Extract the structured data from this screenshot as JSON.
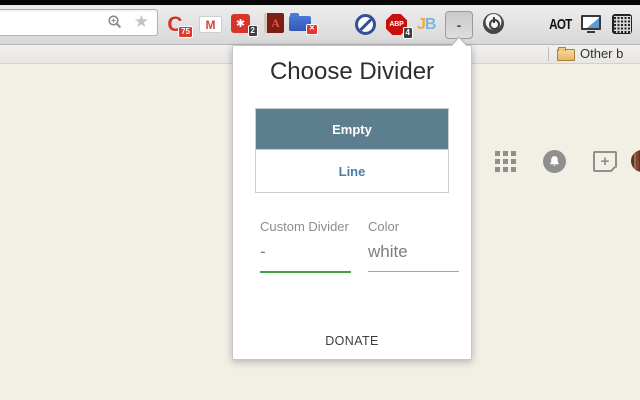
{
  "colors": {
    "page-bg": "#f2f0e5",
    "slate": "#5d7e8e",
    "line-text": "#4a7ca8",
    "green": "#43a047",
    "badge-red": "#e0382e",
    "badge-dark": "#3f3f3f"
  },
  "toolbar": {
    "extensions": {
      "c": {
        "glyph": "C",
        "badge": "75"
      },
      "gmail": {
        "glyph": "M"
      },
      "asterisk": {
        "glyph": "✱",
        "badge": "2"
      },
      "book": {
        "glyph": "A"
      },
      "folder": {
        "badge": "✕"
      },
      "abp": {
        "glyph": "ABP",
        "badge": "4"
      },
      "jb": {
        "j": "J",
        "b": "B"
      },
      "divider": {
        "glyph": "-"
      },
      "aot": {
        "glyph": "AOT"
      }
    }
  },
  "bookmarks_bar": {
    "other_bookmarks_label": "Other b"
  },
  "page": {
    "add_box_glyph": "+"
  },
  "popup": {
    "title": "Choose Divider",
    "empty_button": "Empty",
    "line_button": "Line",
    "custom_divider": {
      "label": "Custom Divider",
      "value": "-"
    },
    "color_field": {
      "label": "Color",
      "value": "white"
    },
    "donate": "DONATE"
  }
}
